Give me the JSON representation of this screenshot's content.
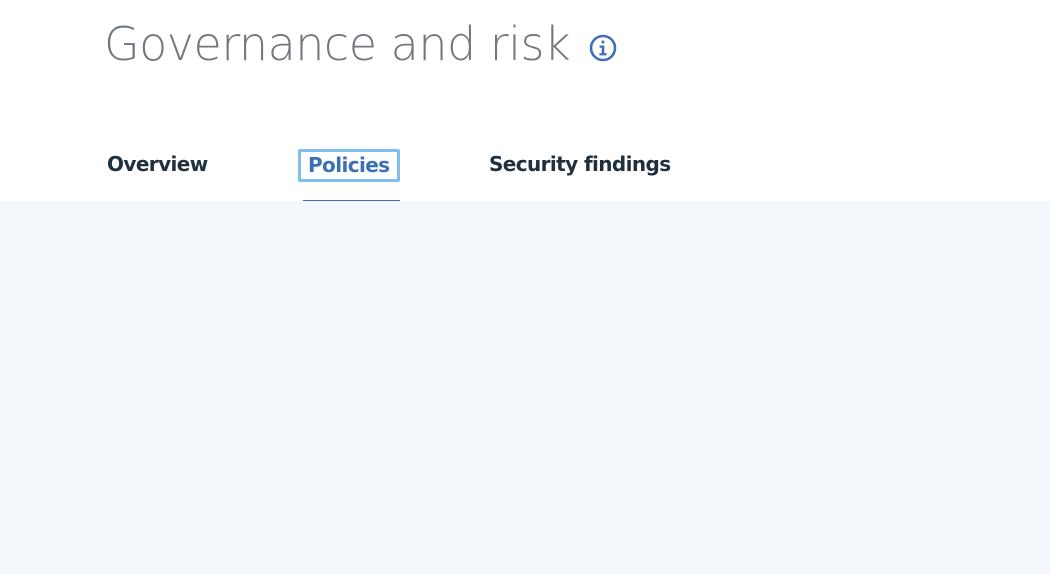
{
  "header": {
    "title": "Governance and risk",
    "info_icon": "info-icon"
  },
  "tabs": [
    {
      "label": "Overview",
      "selected": false
    },
    {
      "label": "Policies",
      "selected": true
    },
    {
      "label": "Security findings",
      "selected": false
    }
  ],
  "colors": {
    "title": "#6f7780",
    "tab_text": "#21303c",
    "tab_active": "#3d6fb3",
    "focus_ring": "#7dbff0",
    "content_background": "#f3f6fa"
  }
}
